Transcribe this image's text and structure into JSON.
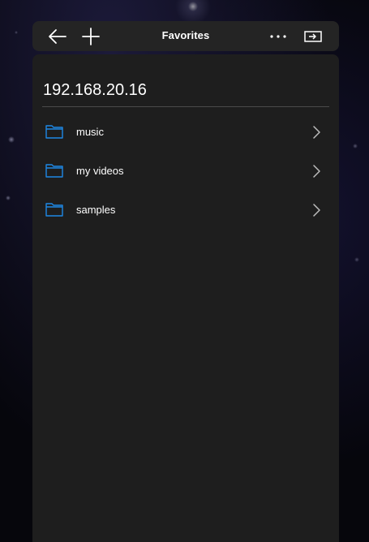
{
  "titlebar": {
    "title": "Favorites",
    "icons": {
      "back": "arrow-left-icon",
      "add": "plus-icon",
      "more": "more-dots-icon",
      "cast": "cast-to-device-icon"
    }
  },
  "main": {
    "host": "192.168.20.16",
    "items": [
      {
        "label": "music",
        "icon": "folder-icon"
      },
      {
        "label": "my videos",
        "icon": "folder-icon"
      },
      {
        "label": "samples",
        "icon": "folder-icon"
      }
    ]
  },
  "colors": {
    "accent": "#1e88e5",
    "titlebar_bg": "#242424",
    "content_bg": "#1e1e1e",
    "text": "#ffffff"
  }
}
